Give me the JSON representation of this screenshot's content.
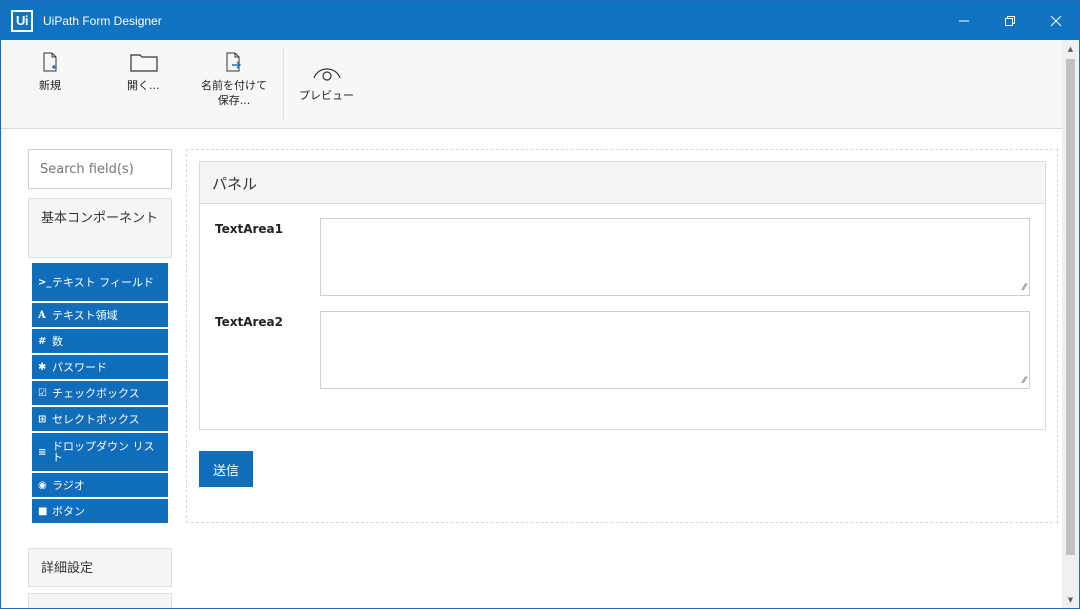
{
  "window": {
    "title": "UiPath Form Designer",
    "logo": "Ui",
    "controls": [
      "minimize-icon",
      "restore-icon",
      "close-icon"
    ],
    "accent": "#0f73c1"
  },
  "toolbar": {
    "new_label": "新規",
    "open_label": "開く...",
    "saveas_line1": "名前を付けて",
    "saveas_line2": "保存...",
    "preview_label": "プレビュー"
  },
  "sidebar": {
    "search_placeholder": "Search field(s)",
    "basic_category": "基本コンポーネント",
    "advanced_category": "詳細設定",
    "components": [
      {
        "icon": "terminal-icon",
        "glyph": ">_",
        "label": "テキスト フィールド"
      },
      {
        "icon": "font-icon",
        "glyph": "A",
        "label": "テキスト領域"
      },
      {
        "icon": "hash-icon",
        "glyph": "#",
        "label": "数"
      },
      {
        "icon": "asterisk-icon",
        "glyph": "✱",
        "label": "パスワード"
      },
      {
        "icon": "check-square-icon",
        "glyph": "☑",
        "label": "チェックボックス"
      },
      {
        "icon": "plus-square-icon",
        "glyph": "⊞",
        "label": "セレクトボックス"
      },
      {
        "icon": "list-icon",
        "glyph": "≡",
        "label": "ドロップダウン リスト"
      },
      {
        "icon": "radio-icon",
        "glyph": "◉",
        "label": "ラジオ"
      },
      {
        "icon": "stop-icon",
        "glyph": "■",
        "label": "ボタン"
      }
    ]
  },
  "form": {
    "panel_title": "パネル",
    "fields": [
      {
        "label": "TextArea1",
        "value": ""
      },
      {
        "label": "TextArea2",
        "value": ""
      }
    ],
    "submit_label": "送信"
  }
}
